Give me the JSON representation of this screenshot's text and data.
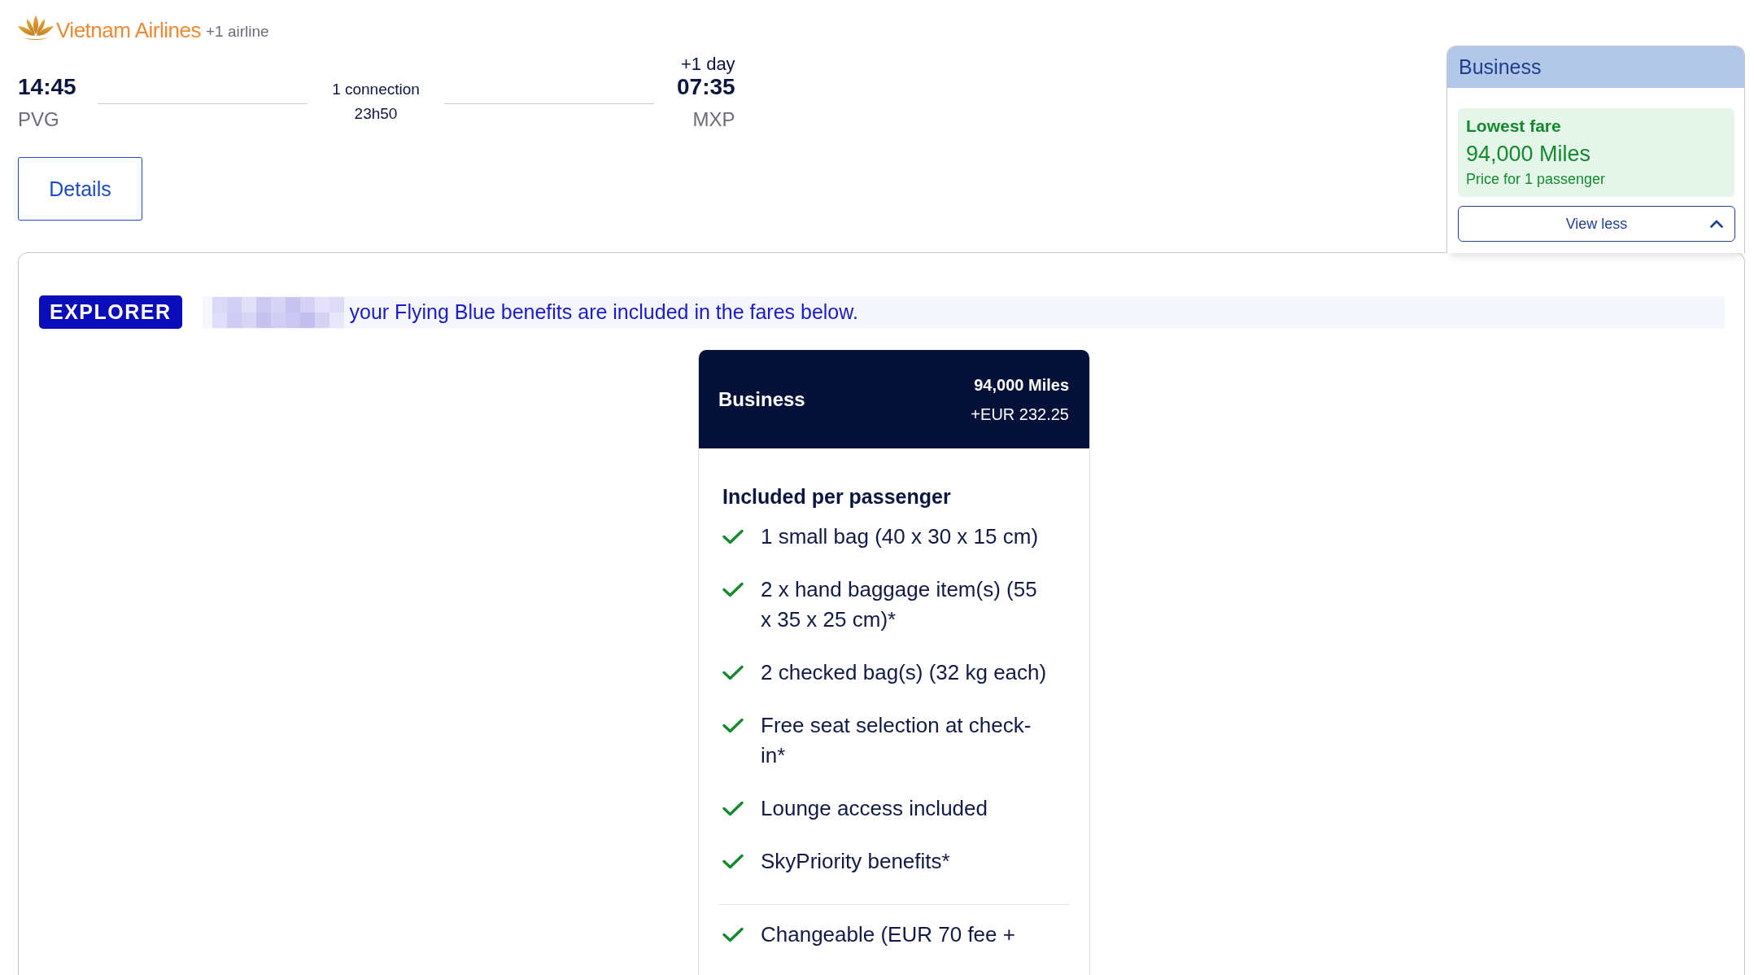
{
  "flight": {
    "airline": {
      "name": "Vietnam Airlines",
      "extra": "+1 airline"
    },
    "departure": {
      "time": "14:45",
      "airport": "PVG"
    },
    "connection": {
      "stops": "1 connection",
      "duration": "23h50"
    },
    "arrival": {
      "day_offset": "+1 day",
      "time": "07:35",
      "airport": "MXP"
    },
    "details_button": "Details"
  },
  "cabin_panel": {
    "title": "Business",
    "fare_label": "Lowest fare",
    "price": "94,000 Miles",
    "note": "Price for 1 passenger",
    "toggle": {
      "label": "View less",
      "expanded": true
    }
  },
  "status_banner": {
    "badge": "EXPLORER",
    "message": "your Flying Blue benefits are included in the fares below."
  },
  "fare_card": {
    "name": "Business",
    "miles": "94,000 Miles",
    "surcharge": "+EUR 232.25",
    "section_title": "Included per passenger",
    "feature_groups": [
      {
        "items": [
          {
            "text": "1 small bag (40 x 30 x 15 cm)",
            "included": true
          },
          {
            "text": "2 x hand baggage item(s) (55 x 35 x 25 cm)*",
            "included": true
          },
          {
            "text": "2 checked bag(s) (32 kg each)",
            "included": true
          },
          {
            "text": "Free seat selection at check-in*",
            "included": true
          },
          {
            "text": "Lounge access included",
            "included": true
          },
          {
            "text": "SkyPriority benefits*",
            "included": true
          }
        ]
      },
      {
        "items": [
          {
            "text": "Changeable (EUR 70 fee +",
            "included": true
          }
        ]
      }
    ]
  }
}
